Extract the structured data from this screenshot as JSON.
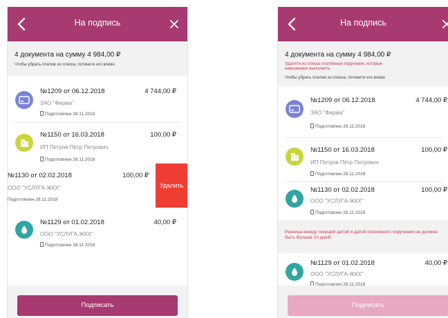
{
  "colors": {
    "header": "#a73a70",
    "sign_enabled": "#a73a70",
    "sign_disabled": "#e7a8c0",
    "delete": "#f03d33",
    "error_text": "#d0334e",
    "icon_card": "#7b83d6",
    "icon_building": "#c8d43b",
    "icon_drop": "#31a5a3"
  },
  "icons": {
    "back": "chevron-left",
    "close": "x",
    "card": "credit-card",
    "building": "buildings",
    "drop": "water-drop",
    "status": "document"
  },
  "screen1": {
    "header": {
      "title": "На подпись"
    },
    "summary": {
      "total": "4 документа на сумму 4 984,00 ₽",
      "hint": "Чтобы убрать платеж из списка, потяните его влево"
    },
    "items": [
      {
        "doc": "№1209 от 06.12.2018",
        "amount": "4 744,00 ₽",
        "org": "ЗАО \"Фирма\"",
        "status": "Подготовлен 28.11.2018"
      },
      {
        "doc": "№1150 от 16.03.2018",
        "amount": "100,00 ₽",
        "org": "ИП Петров Пётр Петрович",
        "status": "Подготовлен 28.11.2018"
      },
      {
        "doc": "№1130 от 02.02.2018",
        "amount": "100,00 ₽",
        "org": "ООО \"УСЛУГА-ЖКХ\"",
        "status": "Подготовлен 28.11.2018"
      },
      {
        "doc": "№1129 от 01.02.2018",
        "amount": "40,00 ₽",
        "org": "ООО \"УСЛУГА-ЖКХ\"",
        "status": "Подготовлен 28.11.2018"
      }
    ],
    "delete_label": "Удалить",
    "sign_label": "Подписать"
  },
  "screen2": {
    "header": {
      "title": "На подпись"
    },
    "summary": {
      "total": "4 документа на сумму 4 984,00 ₽",
      "error": "Удалите из списка платёжные поручения, которые невозможно выполнить",
      "hint": "Чтобы убрать платеж из списка, потяните его влево"
    },
    "items": [
      {
        "doc": "№1209 от 06.12.2018",
        "amount": "4 744,00 ₽",
        "org": "ЗАО \"Фирма\"",
        "status": "Подготовлен 28.11.2018"
      },
      {
        "doc": "№1150 от 16.03.2018",
        "amount": "100,00 ₽",
        "org": "ИП Петров Пётр Петрович",
        "status": "Подготовлен 28.11.2018"
      },
      {
        "doc": "№1130 от 02.02.2018",
        "amount": "100,00 ₽",
        "org": "ООО \"УСЛУГА-ЖКХ\"",
        "status": "Подготовлен 28.11.2018"
      },
      {
        "doc": "№1129 от 01.02.2018",
        "amount": "40,00 ₽",
        "org": "ООО \"УСЛУГА-ЖКХ\"",
        "status": "Подготовлен 28.11.2018"
      }
    ],
    "warning": "Разница между текущей датой и датой платежного поручения не должна быть больше 10 дней!",
    "sign_label": "Подписать"
  }
}
